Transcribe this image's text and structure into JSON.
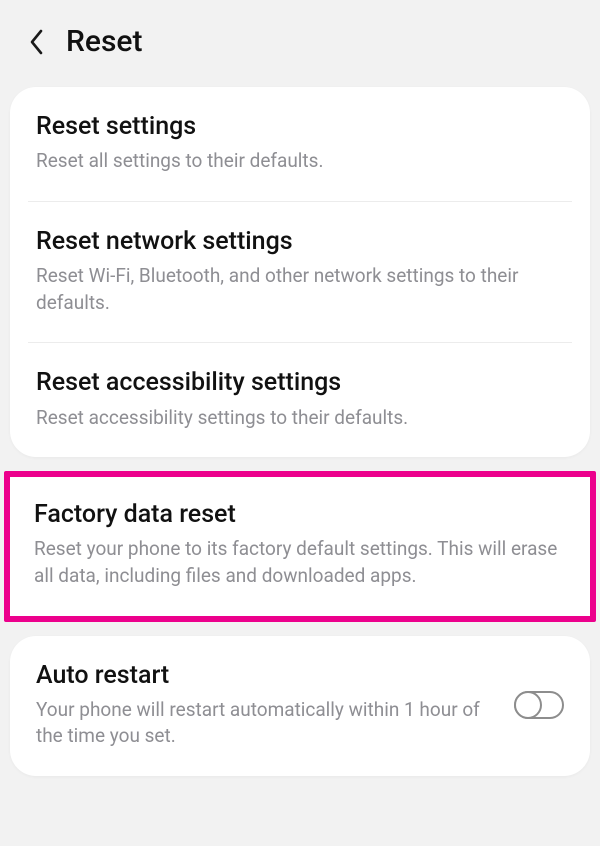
{
  "header": {
    "title": "Reset"
  },
  "items": [
    {
      "title": "Reset settings",
      "desc": "Reset all settings to their defaults."
    },
    {
      "title": "Reset network settings",
      "desc": "Reset Wi-Fi, Bluetooth, and other network settings to their defaults."
    },
    {
      "title": "Reset accessibility settings",
      "desc": "Reset accessibility settings to their defaults."
    },
    {
      "title": "Factory data reset",
      "desc": "Reset your phone to its factory default settings. This will erase all data, including files and downloaded apps."
    }
  ],
  "auto_restart": {
    "title": "Auto restart",
    "desc": "Your phone will restart automatically within 1 hour of the time you set.",
    "enabled": false
  },
  "highlight_color": "#ec008c"
}
